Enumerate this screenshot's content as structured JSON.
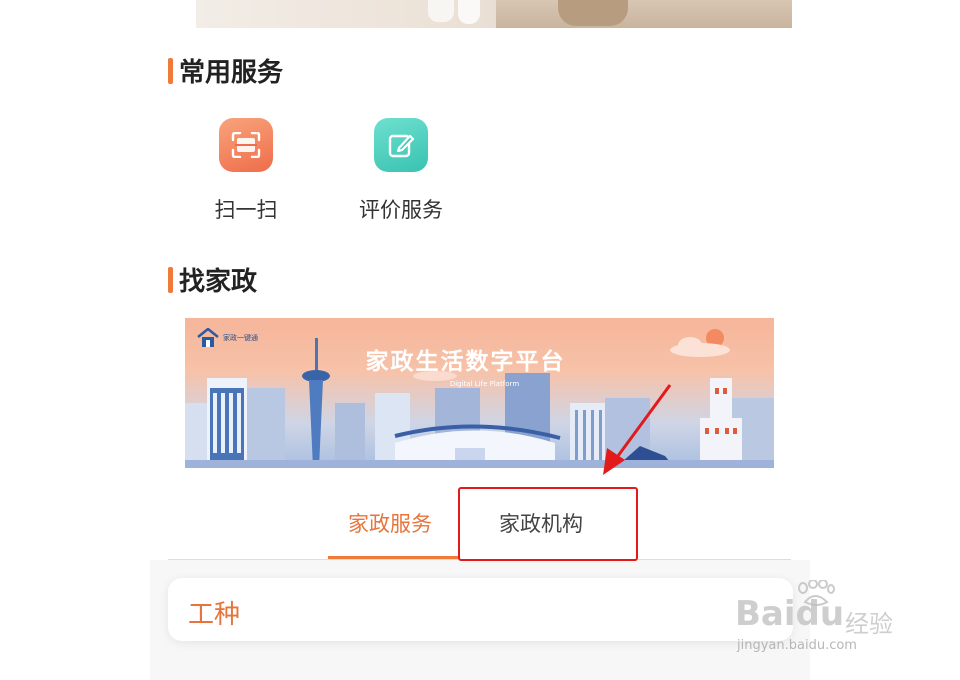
{
  "sections": {
    "common_services": "常用服务",
    "find_housekeeping": "找家政"
  },
  "services": [
    {
      "label": "扫一扫",
      "icon": "scan-icon",
      "color": "#f07a52"
    },
    {
      "label": "评价服务",
      "icon": "edit-review-icon",
      "color": "#45c8b7"
    }
  ],
  "banner": {
    "logo_text": "家政一键通",
    "headline": "家政生活数字平台",
    "subtitle": "Digital Life Platform"
  },
  "tabs": [
    {
      "label": "家政服务",
      "active": true
    },
    {
      "label": "家政机构",
      "active": false
    }
  ],
  "filter": {
    "label": "工种"
  },
  "watermark": {
    "brand": "Baidu",
    "suffix": "经验",
    "url": "jingyan.baidu.com"
  },
  "colors": {
    "accent": "#f07a3a",
    "annotation": "#e31a1a"
  }
}
